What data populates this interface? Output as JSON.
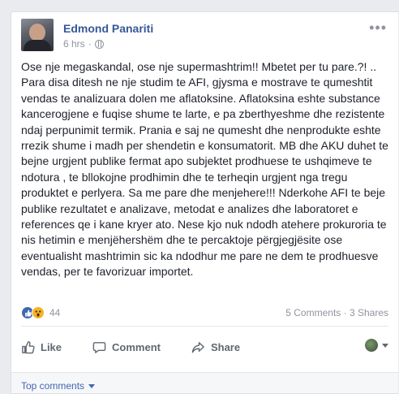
{
  "post": {
    "author": "Edmond Panariti",
    "time": "6 hrs",
    "privacy_icon": "globe-icon",
    "more_icon": "more-options-icon",
    "text": "Ose nje megaskandal, ose nje supermashtrim!! Mbetet per tu pare.?! .. Para disa ditesh ne nje studim te AFI, gjysma e mostrave te qumeshtit vendas te analizuara dolen me aflatoksine. Aflatoksina eshte substance kancerogjene e fuqise shume te larte, e pa zberthyeshme dhe rezistente ndaj perpunimit termik. Prania e saj ne qumesht dhe nenprodukte eshte rrezik shume i madh per shendetin e konsumatorit. MB dhe AKU duhet te bejne urgjent publike fermat apo subjektet prodhuese te ushqimeve te ndotura , te bllokojne prodhimin dhe te terheqin urgjent nga tregu produktet e perlyera. Sa me pare dhe menjehere!!! Nderkohe AFI te beje publike rezultatet e analizave, metodat e analizes dhe laboratoret e references qe i kane kryer ato. Nese kjo nuk ndodh atehere prokuroria te nis hetimin e menjëhershëm dhe te percaktoje përgjegjësite ose eventualisht mashtrimin sic ka ndodhur me pare ne dem te prodhuesve vendas, per te favorizuar importet."
  },
  "stats": {
    "reaction_count": "44",
    "reactions": [
      "like",
      "wow"
    ],
    "comments": "5 Comments",
    "shares": "3 Shares"
  },
  "actions": {
    "like": "Like",
    "comment": "Comment",
    "share": "Share"
  },
  "comments_section": {
    "sort_label": "Top comments"
  }
}
